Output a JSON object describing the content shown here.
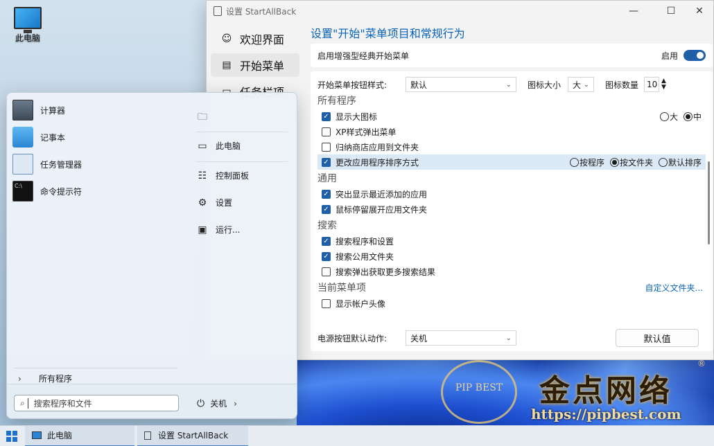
{
  "desktop": {
    "icon_label": "此电脑"
  },
  "window": {
    "title": "设置 StartAllBack",
    "controls": {
      "minimize": "—",
      "maximize": "☐",
      "close": "✕"
    },
    "nav": [
      {
        "label": "欢迎界面",
        "icon": "smile-icon"
      },
      {
        "label": "开始菜单",
        "icon": "start-menu-icon"
      },
      {
        "label": "任务栏项",
        "icon": "taskbar-icon"
      }
    ],
    "page_title": "设置\"开始\"菜单项目和常规行为",
    "enhanced": {
      "label": "启用增强型经典开始菜单",
      "state_label": "启用"
    },
    "button_style": {
      "label": "开始菜单按钮样式:",
      "value": "默认"
    },
    "icon_size": {
      "label": "图标大小",
      "value": "大"
    },
    "icon_count": {
      "label": "图标数量",
      "value": "10"
    },
    "sections": {
      "all_programs": "所有程序",
      "general": "通用",
      "search": "搜索",
      "current_items": "当前菜单项"
    },
    "options": {
      "large_icons": "显示大图标",
      "xp_popup": "XP样式弹出菜单",
      "store_apps": "归纳商店应用到文件夹",
      "sort_apps": "更改应用程序排序方式",
      "highlight_new": "突出显示最近添加的应用",
      "hover_expand": "鼠标停留展开应用文件夹",
      "search_programs": "搜索程序和设置",
      "search_public": "搜索公用文件夹",
      "search_more": "搜索弹出获取更多搜索结果",
      "show_avatar": "显示帐户头像"
    },
    "size_radios": [
      "大",
      "中"
    ],
    "sort_radios": [
      "按程序",
      "按文件夹",
      "默认排序"
    ],
    "customize_link": "自定义文件夹...",
    "power_action": {
      "label": "电源按钮默认动作:",
      "value": "关机"
    },
    "default_button": "默认值"
  },
  "start_menu": {
    "apps": [
      {
        "label": "计算器",
        "icon": "calculator-icon"
      },
      {
        "label": "记事本",
        "icon": "notepad-icon"
      },
      {
        "label": "任务管理器",
        "icon": "task-manager-icon"
      },
      {
        "label": "命令提示符",
        "icon": "cmd-icon"
      }
    ],
    "right_links": [
      {
        "label": "此电脑",
        "icon": "computer-icon"
      },
      {
        "label": "控制面板",
        "icon": "control-panel-icon"
      },
      {
        "label": "设置",
        "icon": "gear-icon"
      },
      {
        "label": "运行...",
        "icon": "run-icon"
      }
    ],
    "all_programs": "所有程序",
    "search_placeholder": "搜索程序和文件",
    "shutdown": "关机"
  },
  "taskbar": {
    "items": [
      {
        "label": "此电脑",
        "icon": "computer-icon"
      },
      {
        "label": "设置 StartAllBack",
        "icon": "settings-window-icon"
      }
    ]
  },
  "watermark": {
    "brand": "金点网络",
    "url": "https://pipbest.com",
    "seal": "PIP BEST",
    "reg": "®"
  },
  "colors": {
    "accent": "#1f5fa7",
    "link": "#0a63b5",
    "highlight_row": "#dbe8f6"
  }
}
